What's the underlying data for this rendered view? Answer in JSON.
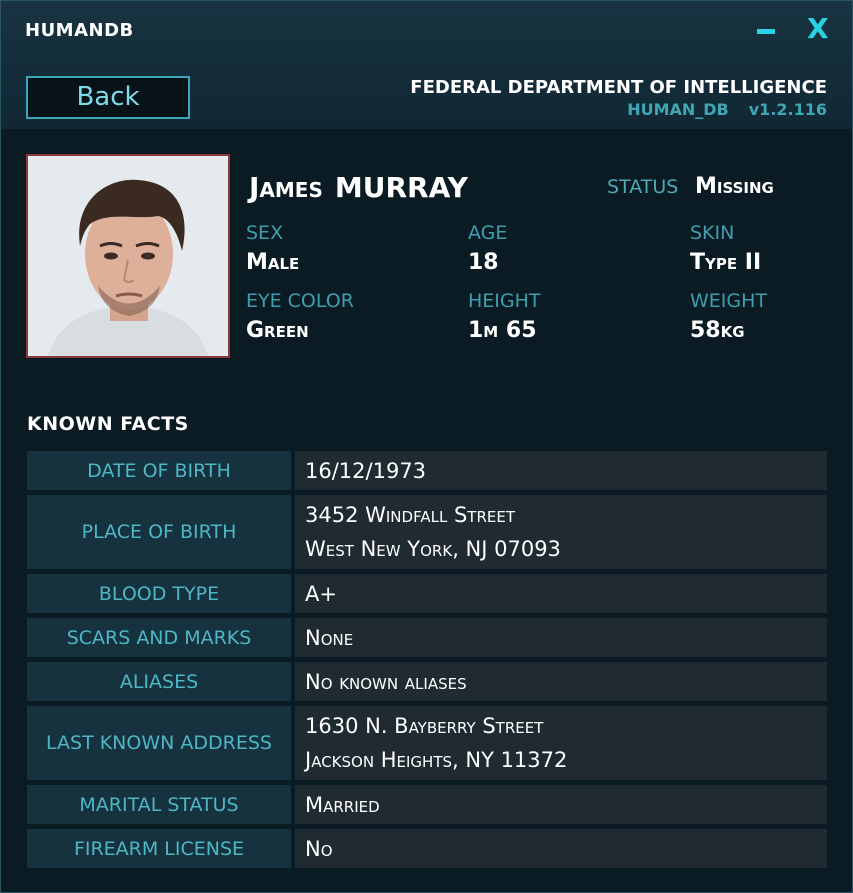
{
  "window": {
    "title": "HUMANDB",
    "minimize_icon": "minimize-icon",
    "close_label": "X"
  },
  "header": {
    "back_label": "Back",
    "org": "FEDERAL DEPARTMENT OF INTELLIGENCE",
    "db_name": "HUMAN_DB",
    "version": "v1.2.116"
  },
  "profile": {
    "first_name": "James",
    "last_name": "MURRAY",
    "status_label": "STATUS",
    "status_value": "Missing",
    "attributes": [
      {
        "label": "SEX",
        "value": "Male"
      },
      {
        "label": "AGE",
        "value": "18"
      },
      {
        "label": "SKIN",
        "value": "Type II"
      },
      {
        "label": "EYE COLOR",
        "value": "Green"
      },
      {
        "label": "HEIGHT",
        "value": "1m 65"
      },
      {
        "label": "WEIGHT",
        "value": "58kg"
      }
    ]
  },
  "facts": {
    "title": "KNOWN FACTS",
    "rows": [
      {
        "label": "DATE OF BIRTH",
        "value": "16/12/1973"
      },
      {
        "label": "PLACE OF BIRTH",
        "value": "3452 Windfall Street",
        "value2": "West New York, NJ 07093"
      },
      {
        "label": "BLOOD TYPE",
        "value": "A+"
      },
      {
        "label": "SCARS AND MARKS",
        "value": "None"
      },
      {
        "label": "ALIASES",
        "value": "No known aliases"
      },
      {
        "label": "LAST KNOWN ADDRESS",
        "value": "1630 N. Bayberry Street",
        "value2": "Jackson Heights, NY 11372"
      },
      {
        "label": "MARITAL STATUS",
        "value": "Married"
      },
      {
        "label": "FIREARM LICENSE",
        "value": "No"
      }
    ]
  },
  "colors": {
    "accent": "#28d4e4",
    "label": "#4eb6c5",
    "background": "#0b1b23"
  }
}
